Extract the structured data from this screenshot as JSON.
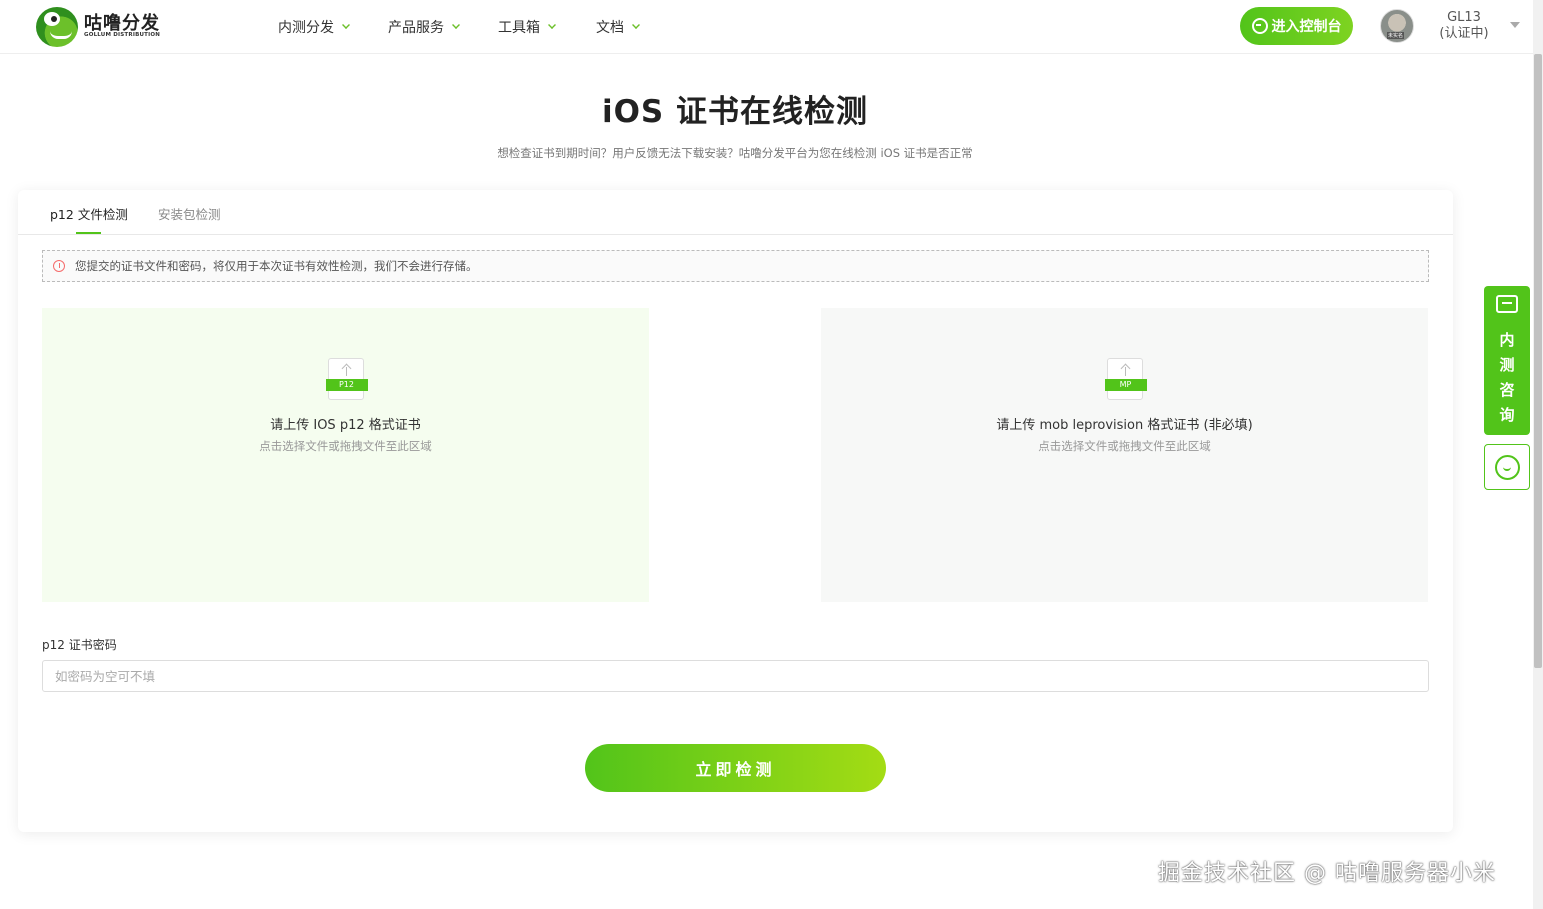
{
  "header": {
    "logo_title": "咕噜分发",
    "logo_subtitle": "GOLLUM DISTRIBUTION",
    "nav": [
      {
        "label": "内测分发"
      },
      {
        "label": "产品服务"
      },
      {
        "label": "工具箱"
      },
      {
        "label": "文档"
      }
    ],
    "console_button": "进入控制台",
    "user_name": "GL13",
    "user_status": "(认证中)"
  },
  "page": {
    "title": "iOS 证书在线检测",
    "subtitle": "想检查证书到期时间？用户反馈无法下载安装？咕噜分发平台为您在线检测 iOS 证书是否正常"
  },
  "tabs": [
    {
      "label": "p12 文件检测",
      "active": true
    },
    {
      "label": "安装包检测",
      "active": false
    }
  ],
  "notice": "您提交的证书文件和密码，将仅用于本次证书有效性检测，我们不会进行存储。",
  "uploads": [
    {
      "tag": "P12",
      "title": "请上传 IOS p12 格式证书",
      "hint": "点击选择文件或拖拽文件至此区域"
    },
    {
      "tag": "MP",
      "title": "请上传 mob leprovision 格式证书 (非必填)",
      "hint": "点击选择文件或拖拽文件至此区域"
    }
  ],
  "password": {
    "label": "p12 证书密码",
    "placeholder": "如密码为空可不填",
    "value": ""
  },
  "check_button": "立即检测",
  "side": {
    "consult_text": "内测咨询"
  },
  "watermark": "掘金技术社区 @ 咕噜服务器小米",
  "colors": {
    "accent": "#52c41a",
    "accent_light": "#a4dc14",
    "upload_left_bg": "#f5fdef",
    "upload_right_bg": "#f7f8f7"
  }
}
